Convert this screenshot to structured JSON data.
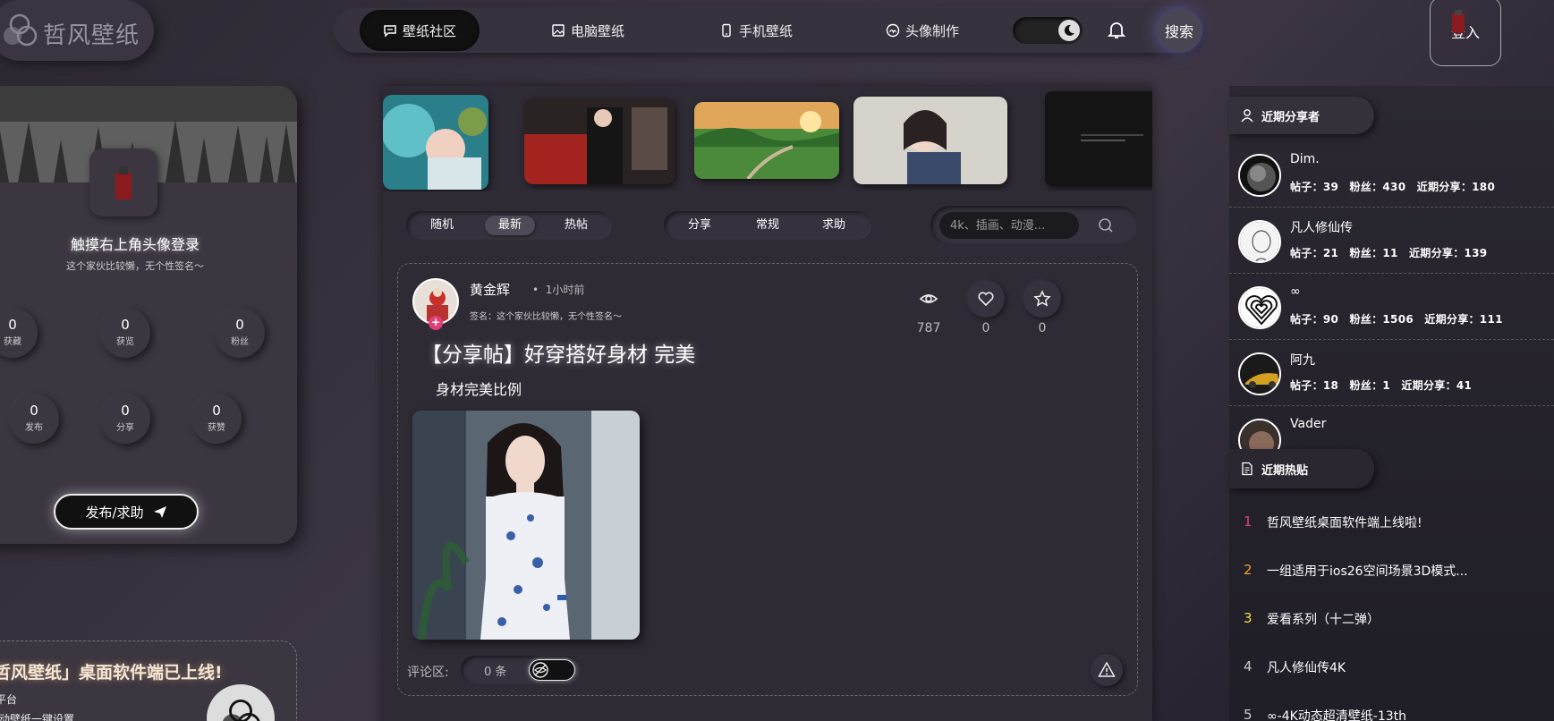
{
  "logo": {
    "name": "哲风壁纸",
    "icon": "three-circles-logo-icon"
  },
  "nav": {
    "tabs": [
      {
        "label": "壁纸社区",
        "icon": "chat-bubble-icon",
        "active": true
      },
      {
        "label": "电脑壁纸",
        "icon": "image-icon"
      },
      {
        "label": "手机壁纸",
        "icon": "phone-icon"
      },
      {
        "label": "头像制作",
        "icon": "avatar-icon"
      }
    ],
    "search": "搜索",
    "login": "登入"
  },
  "profile": {
    "title": "触摸右上角头像登录",
    "subtitle": "这个家伙比较懒，无个性签名～",
    "stats": [
      {
        "value": "0",
        "label": "获藏"
      },
      {
        "value": "0",
        "label": "获览"
      },
      {
        "value": "0",
        "label": "粉丝"
      },
      {
        "value": "0",
        "label": "发布"
      },
      {
        "value": "0",
        "label": "分享"
      },
      {
        "value": "0",
        "label": "获赞"
      }
    ],
    "post_button": "发布/求助"
  },
  "announcement": {
    "title": "哲风壁纸」桌面软件端已上线!",
    "line1": "平台",
    "line2": "/动壁纸一键设置"
  },
  "filters": {
    "sort": [
      "随机",
      "最新",
      "热帖"
    ],
    "sort_active": 1,
    "category": [
      "分享",
      "常规",
      "求助"
    ],
    "search_placeholder": "4k、插画、动漫..."
  },
  "post": {
    "author": "黄金辉",
    "time": "1小时前",
    "signature": "签名：这个家伙比较懒，无个性签名～",
    "title": "【分享帖】好穿搭好身材 完美",
    "body": "身材完美比例",
    "views": "787",
    "likes": "0",
    "favorites": "0",
    "comments_label": "评论区:",
    "comments_count": "0 条"
  },
  "sidebar": {
    "sharers_title": "近期分享者",
    "sharers": [
      {
        "name": "Dim.",
        "stats": "帖子：39　粉丝：430　近期分享：180"
      },
      {
        "name": "凡人修仙传",
        "stats": "帖子：21　粉丝：11　近期分享：139"
      },
      {
        "name": "∞",
        "stats": "帖子：90　粉丝：1506　近期分享：111"
      },
      {
        "name": "阿九",
        "stats": "帖子：18　粉丝：1　近期分享：41"
      },
      {
        "name": "Vader",
        "stats": ""
      }
    ],
    "hot_title": "近期热贴",
    "hot": [
      {
        "rank": "1",
        "title": "哲风壁纸桌面软件端上线啦!",
        "color": "#e0407a"
      },
      {
        "rank": "2",
        "title": "一组适用于ios26空间场景3D模式...",
        "color": "#f0a030"
      },
      {
        "rank": "3",
        "title": "爱看系列（十二弹）",
        "color": "#f0e040"
      },
      {
        "rank": "4",
        "title": "凡人修仙传4K",
        "color": "#cccccc"
      },
      {
        "rank": "5",
        "title": "∞-4K动态超清壁纸-13th",
        "color": "#cccccc"
      }
    ]
  }
}
